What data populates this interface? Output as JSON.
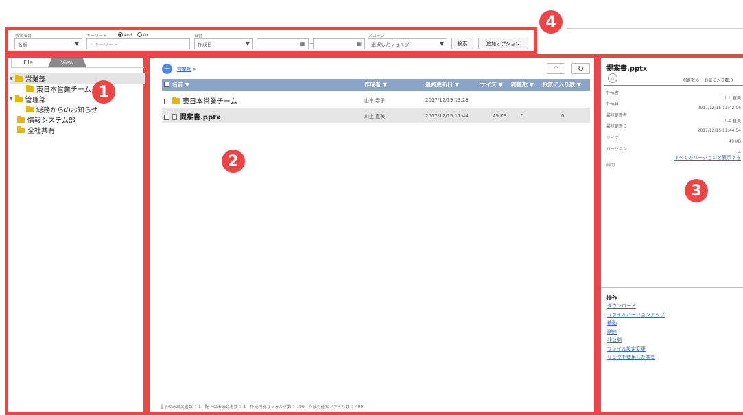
{
  "callouts": [
    "1",
    "2",
    "3",
    "4"
  ],
  "search": {
    "item_label": "検索項目",
    "item_value": "名前",
    "keyword_label": "キーワード",
    "and_label": "And",
    "or_label": "Or",
    "keyword_placeholder": "キーワード",
    "date_label": "日付",
    "date_field_value": "作成日",
    "date_separator": "~",
    "scope_label": "スコープ",
    "scope_value": "選択したフォルダ",
    "search_button": "検索",
    "options_button": "追加オプション"
  },
  "tree": {
    "tabs": [
      "File",
      "View"
    ],
    "nodes": [
      "営業部",
      "東日本営業チーム",
      "管理部",
      "総務からのお知らせ",
      "情報システム部",
      "全社共有"
    ]
  },
  "list": {
    "breadcrumb": "営業部",
    "breadcrumb_sep": ">",
    "headers": {
      "name": "名前 ▼",
      "author": "作成者 ▼",
      "updated": "最終更新日 ▼",
      "size": "サイズ ▼",
      "views": "閲覧数 ▼",
      "favorites": "お気に入り数 ▼"
    },
    "rows": [
      {
        "name": "東日本営業チーム",
        "author": "山本 春子",
        "updated": "2017/12/19 13:28",
        "size": "",
        "views": "",
        "favorites": ""
      },
      {
        "name": "提案書.pptx",
        "author": "川上 直美",
        "updated": "2017/12/15 11:44",
        "size": "49 KB",
        "views": "0",
        "favorites": "0"
      }
    ],
    "footer": "直下の未読文書数 ：1　配下の未読文書数 ：1　作成可能なフォルダ数 ：199　作成可能なファイル数 ：499"
  },
  "detail": {
    "title": "提案書.pptx",
    "views_text": "閲覧数:0",
    "favorites_text": "お気に入り数:0",
    "fields": [
      {
        "label": "作成者",
        "value": "川上 直美"
      },
      {
        "label": "作成日",
        "value": "2017/12/15 11:42:06"
      },
      {
        "label": "最終更新者",
        "value": "川上 直美"
      },
      {
        "label": "最終更新日",
        "value": "2017/12/15 11:44:54"
      },
      {
        "label": "サイズ",
        "value": "49 KB"
      },
      {
        "label": "バージョン",
        "value": "4"
      }
    ],
    "all_versions_link": "すべてのバージョンを表示する",
    "description_label": "説明",
    "operations_title": "操作",
    "operations": [
      "ダウンロード",
      "ファイルバージョンアップ",
      "移動",
      "削除",
      "非公開",
      "ファイル設定変更",
      "リンクを使用した共有"
    ]
  }
}
